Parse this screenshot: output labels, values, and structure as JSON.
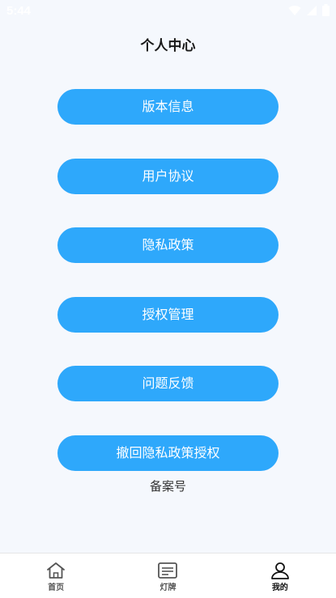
{
  "status_bar": {
    "time": "5:44"
  },
  "header": {
    "title": "个人中心"
  },
  "menu": {
    "items": [
      {
        "label": "版本信息"
      },
      {
        "label": "用户协议"
      },
      {
        "label": "隐私政策"
      },
      {
        "label": "授权管理"
      },
      {
        "label": "问题反馈"
      },
      {
        "label": "撤回隐私政策授权"
      }
    ]
  },
  "footer": {
    "filing_label": "备案号"
  },
  "tab_bar": {
    "tabs": [
      {
        "label": "首页",
        "icon": "home-icon"
      },
      {
        "label": "灯牌",
        "icon": "sign-board-icon"
      },
      {
        "label": "我的",
        "icon": "user-icon",
        "active": true
      }
    ]
  },
  "colors": {
    "accent": "#2ea8fb",
    "background": "#f5f8fd"
  }
}
